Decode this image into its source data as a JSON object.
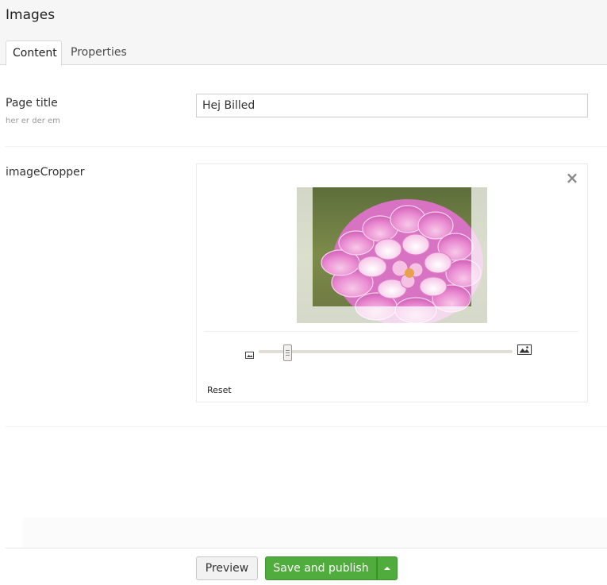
{
  "header": {
    "title": "Images",
    "tabs": [
      {
        "label": "Content",
        "active": true
      },
      {
        "label": "Properties",
        "active": false
      }
    ]
  },
  "properties": {
    "page_title": {
      "label": "Page title",
      "description": "her er der em",
      "value": "Hej Billed"
    },
    "image_cropper": {
      "label": "imageCropper",
      "close_icon": "close-icon",
      "zoom_min_icon": "image-small-icon",
      "zoom_max_icon": "image-large-icon",
      "zoom_level": 0.1,
      "reset_label": "Reset"
    }
  },
  "footer": {
    "preview_label": "Preview",
    "save_publish_label": "Save and publish",
    "options_icon": "caret-up-icon",
    "save_color": "#50ac3c"
  }
}
